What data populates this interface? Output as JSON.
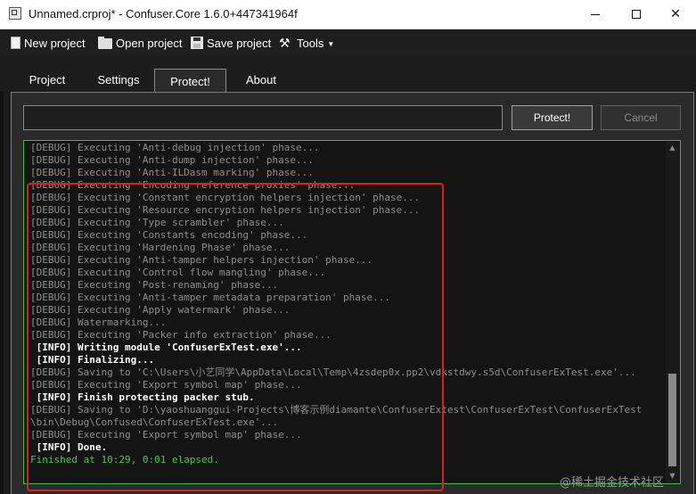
{
  "window": {
    "title": "Unnamed.crproj* - Confuser.Core 1.6.0+447341964f",
    "min_icon": "minimize-icon",
    "max_icon": "maximize-icon",
    "close_glyph": "✕"
  },
  "toolbar": {
    "new_project": "New project",
    "open_project": "Open project",
    "save_project": "Save project",
    "tools": "Tools"
  },
  "tabs": [
    "Project",
    "Settings",
    "Protect!",
    "About"
  ],
  "protect": {
    "input_value": "",
    "protect_button": "Protect!",
    "cancel_button": "Cancel"
  },
  "log": {
    "lines": [
      "[DEBUG] Executing 'Anti-debug injection' phase...",
      "[DEBUG] Executing 'Anti-dump injection' phase...",
      "[DEBUG] Executing 'Anti-ILDasm marking' phase...",
      "[DEBUG] Executing 'Encoding reference proxies' phase...",
      "[DEBUG] Executing 'Constant encryption helpers injection' phase...",
      "[DEBUG] Executing 'Resource encryption helpers injection' phase...",
      "[DEBUG] Executing 'Type scrambler' phase...",
      "[DEBUG] Executing 'Constants encoding' phase...",
      "[DEBUG] Executing 'Hardening Phase' phase...",
      "[DEBUG] Executing 'Anti-tamper helpers injection' phase...",
      "[DEBUG] Executing 'Control flow mangling' phase...",
      "[DEBUG] Executing 'Post-renaming' phase...",
      "[DEBUG] Executing 'Anti-tamper metadata preparation' phase...",
      "[DEBUG] Executing 'Apply watermark' phase...",
      "[DEBUG] Watermarking...",
      "[DEBUG] Executing 'Packer info extraction' phase...",
      " [INFO] Writing module 'ConfuserExTest.exe'...",
      " [INFO] Finalizing...",
      "[DEBUG] Saving to 'C:\\Users\\小艺同学\\AppData\\Local\\Temp\\4zsdep0x.pp2\\vdkstdwy.s5d\\ConfuserExTest.exe'...",
      "[DEBUG] Executing 'Export symbol map' phase...",
      " [INFO] Finish protecting packer stub.",
      "[DEBUG] Saving to 'D:\\yaoshuanggui-Projects\\博客示例diamante\\ConfuserExtest\\ConfuserExTest\\ConfuserExTest",
      "\\bin\\Debug\\Confused\\ConfuserExTest.exe'...",
      "[DEBUG] Executing 'Export symbol map' phase...",
      " [INFO] Done.",
      "Finished at 10:29, 0:01 elapsed."
    ]
  },
  "watermark": "@稀土掘金技术社区",
  "colors": {
    "log_border": "#3cb84a",
    "finished_text": "#3fcf3f",
    "annotation": "#d42222"
  }
}
